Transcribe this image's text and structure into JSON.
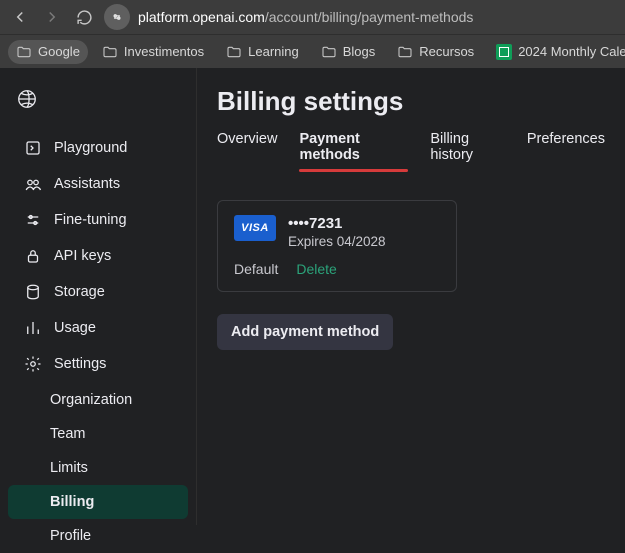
{
  "browser": {
    "url_host": "platform.openai.com",
    "url_path": "/account/billing/payment-methods"
  },
  "bookmarks": [
    {
      "label": "Google",
      "kind": "folder",
      "active": true
    },
    {
      "label": "Investimentos",
      "kind": "folder"
    },
    {
      "label": "Learning",
      "kind": "folder"
    },
    {
      "label": "Blogs",
      "kind": "folder"
    },
    {
      "label": "Recursos",
      "kind": "folder"
    },
    {
      "label": "2024 Monthly Calen...",
      "kind": "sheets"
    },
    {
      "label": "",
      "kind": "linkedin"
    }
  ],
  "sidebar": {
    "items": [
      {
        "label": "Playground",
        "icon": "playground-icon"
      },
      {
        "label": "Assistants",
        "icon": "assistants-icon"
      },
      {
        "label": "Fine-tuning",
        "icon": "finetune-icon"
      },
      {
        "label": "API keys",
        "icon": "lock-icon"
      },
      {
        "label": "Storage",
        "icon": "storage-icon"
      },
      {
        "label": "Usage",
        "icon": "usage-icon"
      },
      {
        "label": "Settings",
        "icon": "gear-icon"
      }
    ],
    "subitems": [
      {
        "label": "Organization"
      },
      {
        "label": "Team"
      },
      {
        "label": "Limits"
      },
      {
        "label": "Billing",
        "active": true
      },
      {
        "label": "Profile"
      }
    ]
  },
  "main": {
    "title": "Billing settings",
    "tabs": [
      {
        "label": "Overview"
      },
      {
        "label": "Payment methods",
        "active": true
      },
      {
        "label": "Billing history"
      },
      {
        "label": "Preferences"
      }
    ],
    "card": {
      "brand": "VISA",
      "masked": "••••7231",
      "expires": "Expires 04/2028",
      "default_label": "Default",
      "delete_label": "Delete"
    },
    "add_button": "Add payment method"
  }
}
